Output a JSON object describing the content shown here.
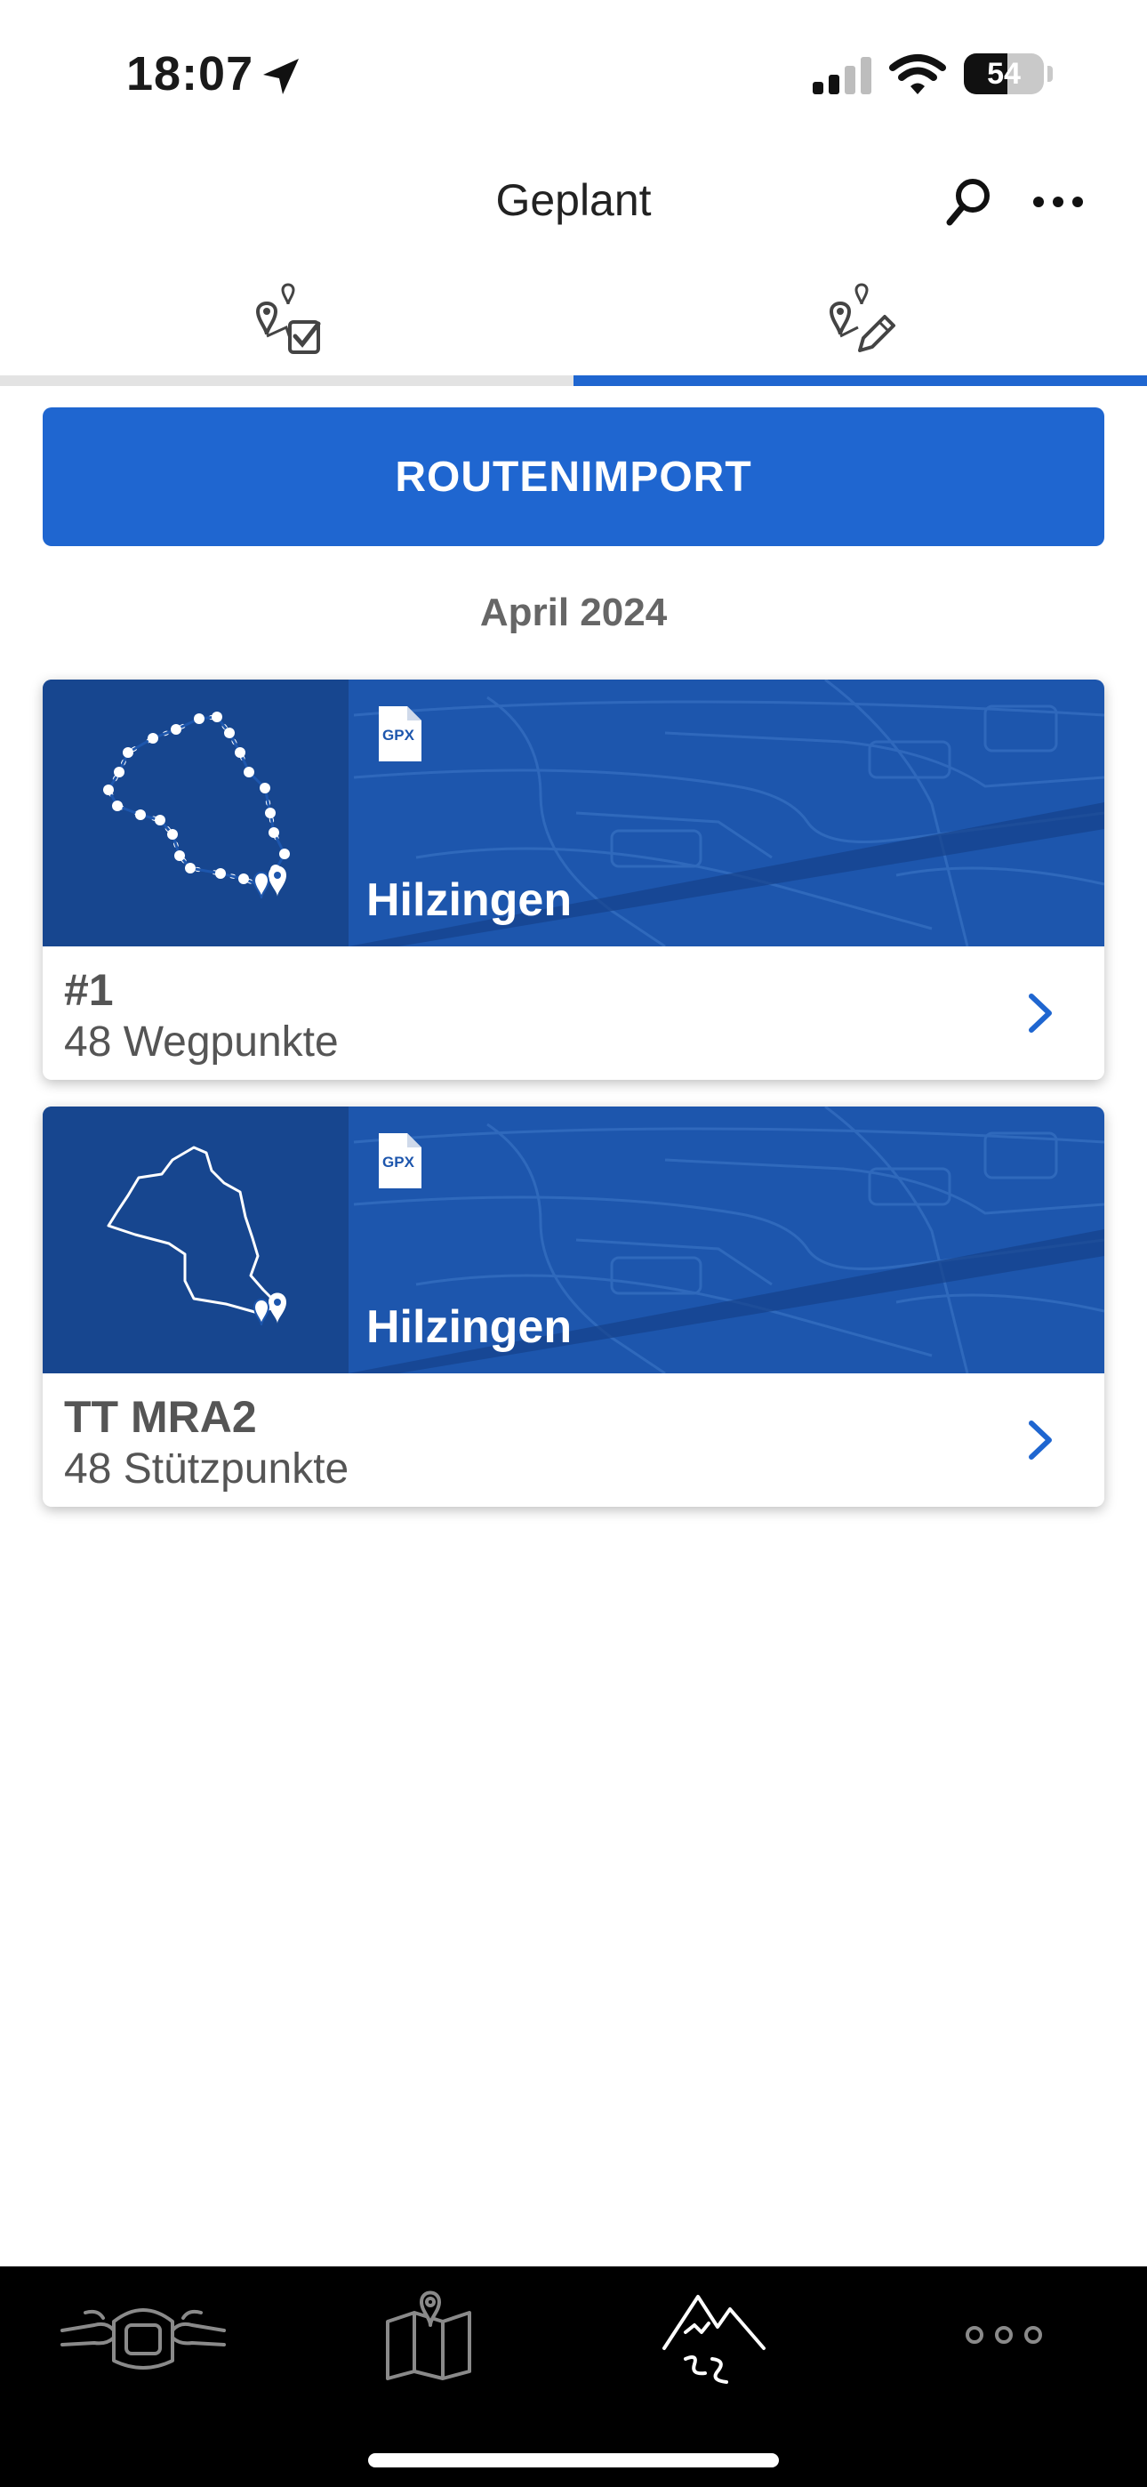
{
  "status_bar": {
    "time": "18:07",
    "battery_level": "54",
    "battery_fraction": 0.54
  },
  "header": {
    "title": "Geplant",
    "search_icon": "search-icon",
    "more_icon": "more-horizontal-icon"
  },
  "tabs": [
    {
      "icon": "map-pin-check-icon",
      "selected": false
    },
    {
      "icon": "map-pin-edit-icon",
      "selected": true
    }
  ],
  "import_button": {
    "label": "ROUTENIMPORT"
  },
  "section": {
    "month": "April 2024"
  },
  "routes": [
    {
      "city": "Hilzingen",
      "title": "#1",
      "subtitle": "48 Wegpunkte",
      "file_badge": "GPX",
      "route_style": "dotted"
    },
    {
      "city": "Hilzingen",
      "title": "TT MRA2",
      "subtitle": "48 Stützpunkte",
      "file_badge": "GPX",
      "route_style": "outline"
    }
  ],
  "bottom_nav": [
    {
      "icon": "motorcycle-icon",
      "active": false
    },
    {
      "icon": "map-icon",
      "active": false
    },
    {
      "icon": "mountains-route-icon",
      "active": true
    },
    {
      "icon": "more-dots-icon",
      "active": false
    }
  ],
  "colors": {
    "accent": "#1f66d0",
    "banner": "#1d56ad",
    "banner_dark": "#17468f",
    "tab_inactive": "#e3e3e3",
    "nav_background": "#000000"
  }
}
